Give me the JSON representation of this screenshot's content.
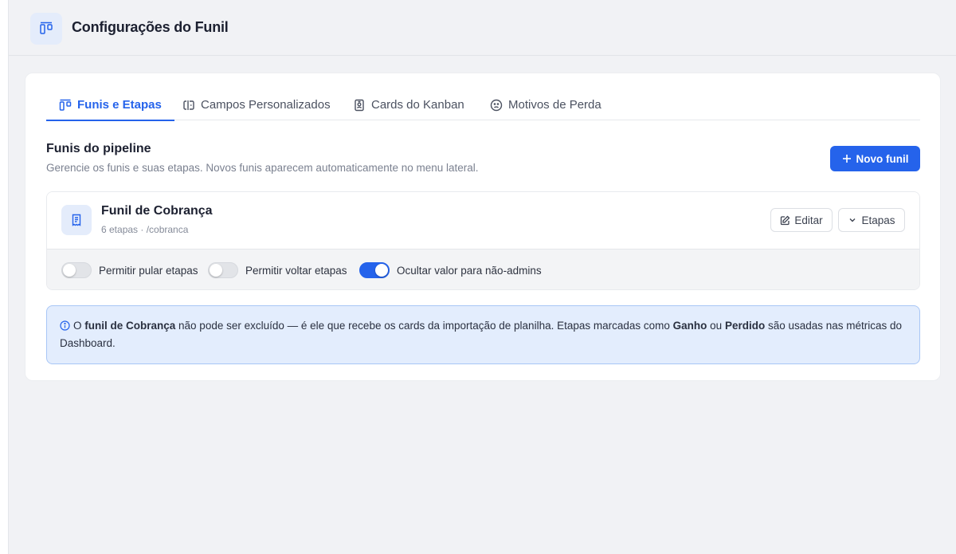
{
  "header": {
    "title": "Configurações do Funil",
    "icon": "kanban-icon"
  },
  "tabs": [
    {
      "label": "Funis e Etapas",
      "icon": "kanban-icon",
      "active": true
    },
    {
      "label": "Campos Personalizados",
      "icon": "text-cursor-input-icon",
      "active": false
    },
    {
      "label": "Cards do Kanban",
      "icon": "id-card-icon",
      "active": false
    },
    {
      "label": "Motivos de Perda",
      "icon": "frown-icon",
      "active": false
    }
  ],
  "section": {
    "title": "Funis do pipeline",
    "subtitle": "Gerencie os funis e suas etapas. Novos funis aparecem automaticamente no menu lateral.",
    "new_button": "Novo funil"
  },
  "funnel": {
    "name": "Funil de Cobrança",
    "meta": "6 etapas · /cobranca",
    "icon": "receipt-icon",
    "edit_label": "Editar",
    "stages_label": "Etapas"
  },
  "toggles": [
    {
      "label": "Permitir pular etapas",
      "on": false
    },
    {
      "label": "Permitir voltar etapas",
      "on": false
    },
    {
      "label": "Ocultar valor para não-admins",
      "on": true
    }
  ],
  "info": {
    "t1": "O ",
    "b1": "funil de Cobrança",
    "t2": " não pode ser excluído — é ele que recebe os cards da importação de planilha. Etapas marcadas como ",
    "b2": "Ganho",
    "t3": " ou ",
    "b3": "Perdido",
    "t4": " são usadas nas métricas do Dashboard."
  },
  "colors": {
    "accent": "#2563eb",
    "background": "#f1f2f5",
    "info_bg": "#e3edfd"
  }
}
